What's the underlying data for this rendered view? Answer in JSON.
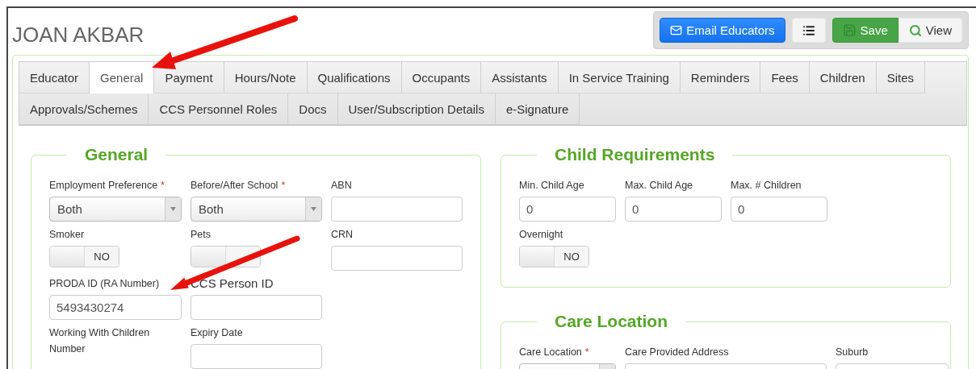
{
  "title": "JOAN AKBAR",
  "toolbar": {
    "buttons": [
      {
        "kind": "primary",
        "label": "Email Educators"
      },
      {
        "kind": "icon"
      },
      {
        "kind": "success",
        "label": "Save"
      },
      {
        "kind": "default",
        "label": "View"
      }
    ]
  },
  "tabs": [
    [
      {
        "label": "Educator",
        "selected": false
      },
      {
        "label": "General",
        "selected": true
      },
      {
        "label": "Payment",
        "selected": false
      },
      {
        "label": "Hours/Note",
        "selected": false
      },
      {
        "label": "Qualifications",
        "selected": false
      },
      {
        "label": "Occupants",
        "selected": false
      },
      {
        "label": "Assistants",
        "selected": false
      },
      {
        "label": "In Service Training",
        "selected": false
      },
      {
        "label": "Reminders",
        "selected": false
      },
      {
        "label": "Fees",
        "selected": false
      },
      {
        "label": "Children",
        "selected": false
      },
      {
        "label": "Sites",
        "selected": false
      }
    ],
    [
      {
        "label": "Approvals/Schemes",
        "selected": false
      },
      {
        "label": "CCS Personnel Roles",
        "selected": false
      },
      {
        "label": "Docs",
        "selected": false
      },
      {
        "label": "User/Subscription Details",
        "selected": false
      },
      {
        "label": "e-Signature",
        "selected": false
      }
    ]
  ],
  "columns": [
    [
      {
        "title": "General",
        "rows": [
          [
            {
              "kind": "select",
              "label": "Employment Preference",
              "required_mark": "*",
              "value": "Both"
            },
            {
              "kind": "select",
              "label": "Before/After School",
              "required_mark": "*",
              "value": "Both"
            },
            {
              "kind": "input",
              "label": "ABN"
            }
          ],
          [
            {
              "kind": "toggle",
              "label": "Smoker",
              "on": false,
              "text": "NO"
            },
            {
              "kind": "toggle",
              "label": "Pets",
              "on": false
            },
            {
              "kind": "input",
              "label": "CRN"
            }
          ],
          [
            {
              "kind": "input",
              "label": "PRODA ID (RA Number)",
              "value": "5493430274"
            },
            {
              "kind": "input",
              "label": "CCS Person ID",
              "large_label": true
            }
          ],
          [
            {
              "kind": "label",
              "label": "Working With Children Number"
            },
            {
              "kind": "input",
              "label": "Expiry Date"
            }
          ]
        ]
      }
    ],
    [
      {
        "title": "Child Requirements",
        "rows": [
          [
            {
              "kind": "input",
              "label": "Min. Child Age",
              "value": "0"
            },
            {
              "kind": "input",
              "label": "Max. Child Age",
              "value": "0"
            },
            {
              "kind": "input",
              "label": "Max. # Children",
              "value": "0"
            }
          ],
          [
            {
              "kind": "toggle",
              "label": "Overnight",
              "on": false,
              "text": "NO"
            }
          ]
        ]
      },
      {
        "title": "Care Location",
        "rows": [
          [
            {
              "kind": "select",
              "label": "Care Location",
              "required_mark": "*"
            },
            {
              "kind": "input",
              "label": "Care Provided Address"
            },
            {
              "kind": "input",
              "label": "Suburb"
            }
          ]
        ]
      }
    ]
  ]
}
